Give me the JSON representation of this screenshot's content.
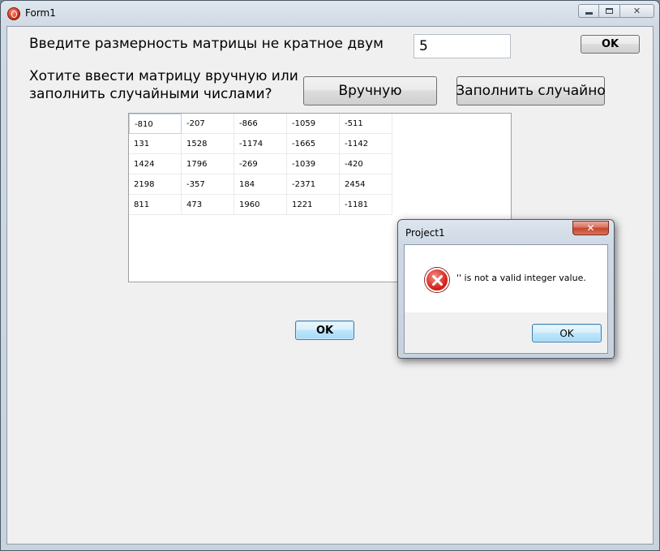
{
  "window": {
    "title": "Form1",
    "caption_buttons": {
      "minimize": "minimize",
      "maximize": "maximize",
      "close": "✕"
    }
  },
  "form": {
    "size_label": "Введите размерность матрицы не кратное двум",
    "size_value": "5",
    "size_ok": "OK",
    "question_line1": "Хотите ввести матрицу вручную или",
    "question_line2": "заполнить случайными числами?",
    "manual_button": "Вручную",
    "random_button": "Заполнить случайно",
    "bottom_ok": "OK"
  },
  "grid": {
    "rows": [
      [
        "-810",
        "-207",
        "-866",
        "-1059",
        "-511"
      ],
      [
        "131",
        "1528",
        "-1174",
        "-1665",
        "-1142"
      ],
      [
        "1424",
        "1796",
        "-269",
        "-1039",
        "-420"
      ],
      [
        "2198",
        "-357",
        "184",
        "-2371",
        "2454"
      ],
      [
        "811",
        "473",
        "1960",
        "1221",
        "-1181"
      ]
    ]
  },
  "dialog": {
    "title": "Project1",
    "close": "✕",
    "icon": "error-icon",
    "message": "'' is not a valid integer value.",
    "ok": "OK"
  }
}
